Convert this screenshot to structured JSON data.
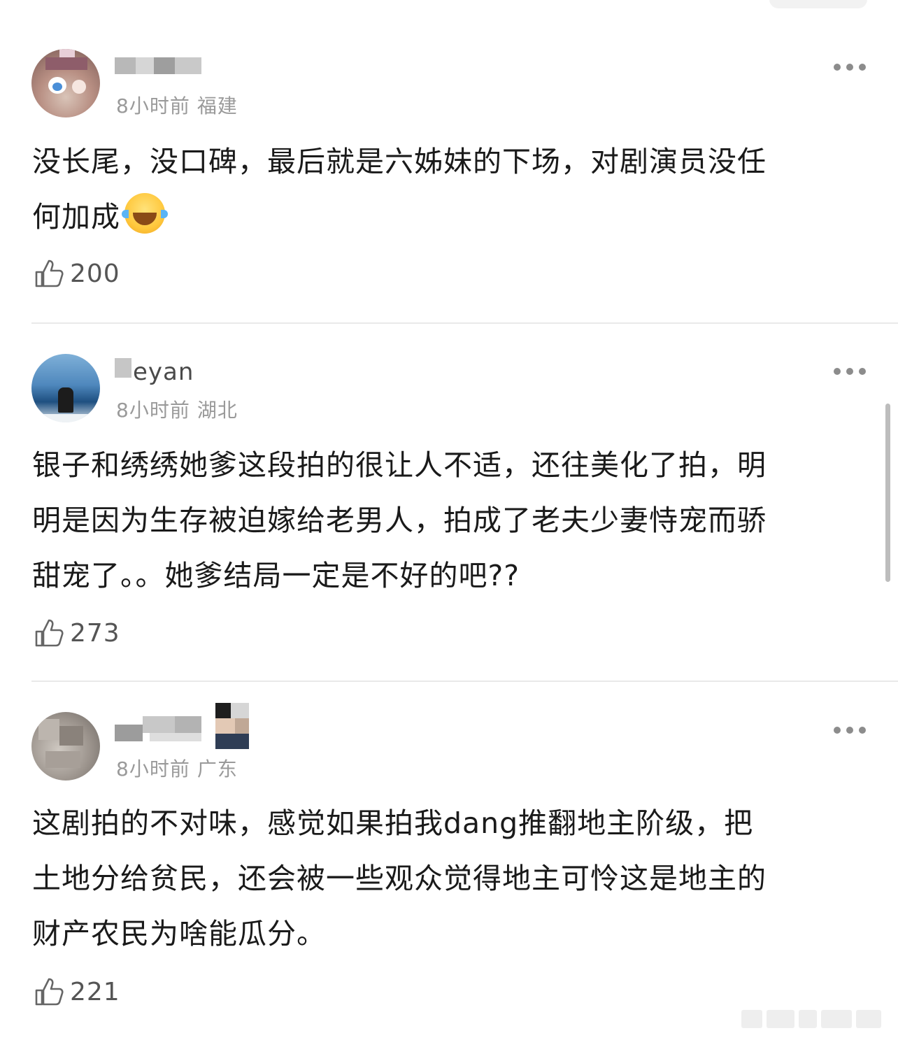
{
  "comments": [
    {
      "username": "",
      "time": "8小时前",
      "location": "福建",
      "text": "没长尾，没口碑，最后就是六姊妹的下场，对剧演员没任\n何加成",
      "emoji": "laughing-crying-emoji",
      "likes": "200"
    },
    {
      "username": "eyan",
      "time": "8小时前",
      "location": "湖北",
      "text": "银子和绣绣她爹这段拍的很让人不适，还往美化了拍，明\n明是因为生存被迫嫁给老男人，拍成了老夫少妻恃宠而骄\n甜宠了。。她爹结局一定是不好的吧??",
      "likes": "273"
    },
    {
      "username": "",
      "time": "8小时前",
      "location": "广东",
      "text": "这剧拍的不对味，感觉如果拍我dang推翻地主阶级，把\n土地分给贫民，还会被一些观众觉得地主可怜这是地主的\n财产农民为啥能瓜分。",
      "likes": "221"
    }
  ],
  "icons": {
    "like": "thumbs-up-icon",
    "more": "more-dots-icon"
  },
  "colors": {
    "text": "#1a1a1a",
    "meta": "#9a9a9a",
    "divider": "#e9e9e9",
    "icon": "#8c8c8c"
  }
}
